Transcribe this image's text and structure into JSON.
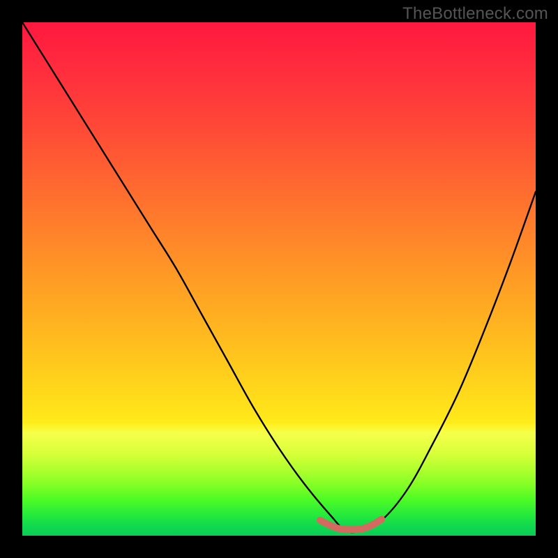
{
  "watermark": "TheBottleneck.com",
  "chart_data": {
    "type": "line",
    "title": "",
    "xlabel": "",
    "ylabel": "",
    "xlim": [
      0,
      100
    ],
    "ylim": [
      0,
      100
    ],
    "grid": false,
    "legend": false,
    "series": [
      {
        "name": "bottleneck-curve",
        "x": [
          0,
          5,
          10,
          15,
          20,
          25,
          30,
          35,
          40,
          45,
          50,
          55,
          60,
          63,
          66,
          70,
          75,
          80,
          85,
          90,
          95,
          100
        ],
        "values": [
          100,
          92,
          84,
          76,
          68,
          60,
          52,
          43,
          34,
          25,
          17,
          10,
          4,
          1,
          1,
          3,
          9,
          18,
          28,
          40,
          53,
          67
        ]
      },
      {
        "name": "optimal-marker",
        "x": [
          58,
          60,
          62,
          64,
          66,
          68,
          70
        ],
        "values": [
          3,
          2,
          1.3,
          1.2,
          1.3,
          2.0,
          3.2
        ]
      }
    ],
    "background_gradient": {
      "stops": [
        {
          "pos": 0.0,
          "color": "#ff183f"
        },
        {
          "pos": 0.38,
          "color": "#ff7a2c"
        },
        {
          "pos": 0.68,
          "color": "#ffcd1c"
        },
        {
          "pos": 0.8,
          "color": "#fff31a"
        },
        {
          "pos": 0.88,
          "color": "#b0ff2e"
        },
        {
          "pos": 0.94,
          "color": "#4dfb26"
        },
        {
          "pos": 1.0,
          "color": "#0acd56"
        }
      ]
    },
    "optimal_marker_color": "#d46a5f"
  }
}
